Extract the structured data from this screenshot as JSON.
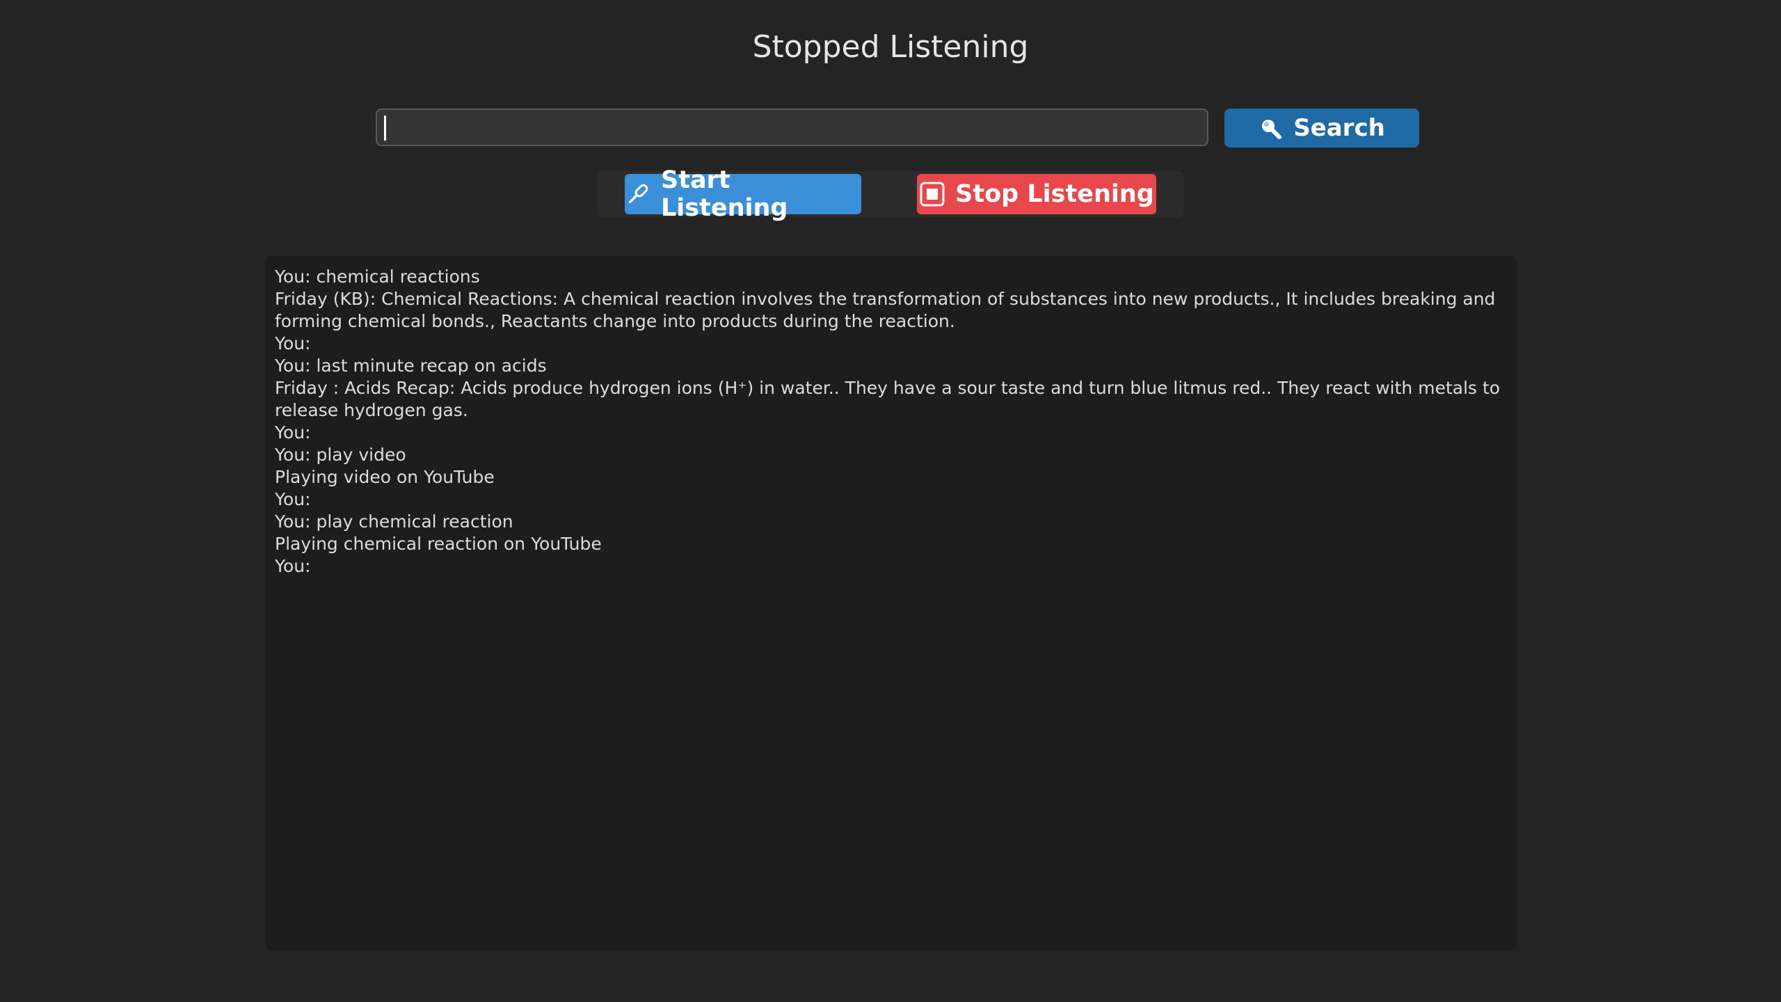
{
  "status": {
    "title": "Stopped Listening"
  },
  "search": {
    "value": "",
    "button_label": "Search",
    "button_icon": "search-icon"
  },
  "controls": {
    "start_label": "Start Listening",
    "start_icon": "microphone-icon",
    "stop_label": "Stop Listening",
    "stop_icon": "stop-icon"
  },
  "transcript": {
    "lines": [
      "You: chemical reactions",
      "Friday (KB): Chemical Reactions: A chemical reaction involves the transformation of substances into new products., It includes breaking and forming chemical bonds., Reactants change into products during the reaction.",
      "You:",
      "You: last minute recap on acids",
      "Friday : Acids Recap: Acids produce hydrogen ions (H⁺) in water.. They have a sour taste and turn blue litmus red.. They react with metals to release hydrogen gas.",
      "You:",
      "You: play video",
      "Playing video on YouTube",
      "You:",
      "You: play chemical reaction",
      "Playing chemical reaction on YouTube",
      "You:"
    ]
  },
  "colors": {
    "background": "#242424",
    "search_button": "#1f6aa5",
    "start_button": "#3b8ed8",
    "stop_button": "#e8474b",
    "transcript_bg": "#1d1d1d"
  }
}
